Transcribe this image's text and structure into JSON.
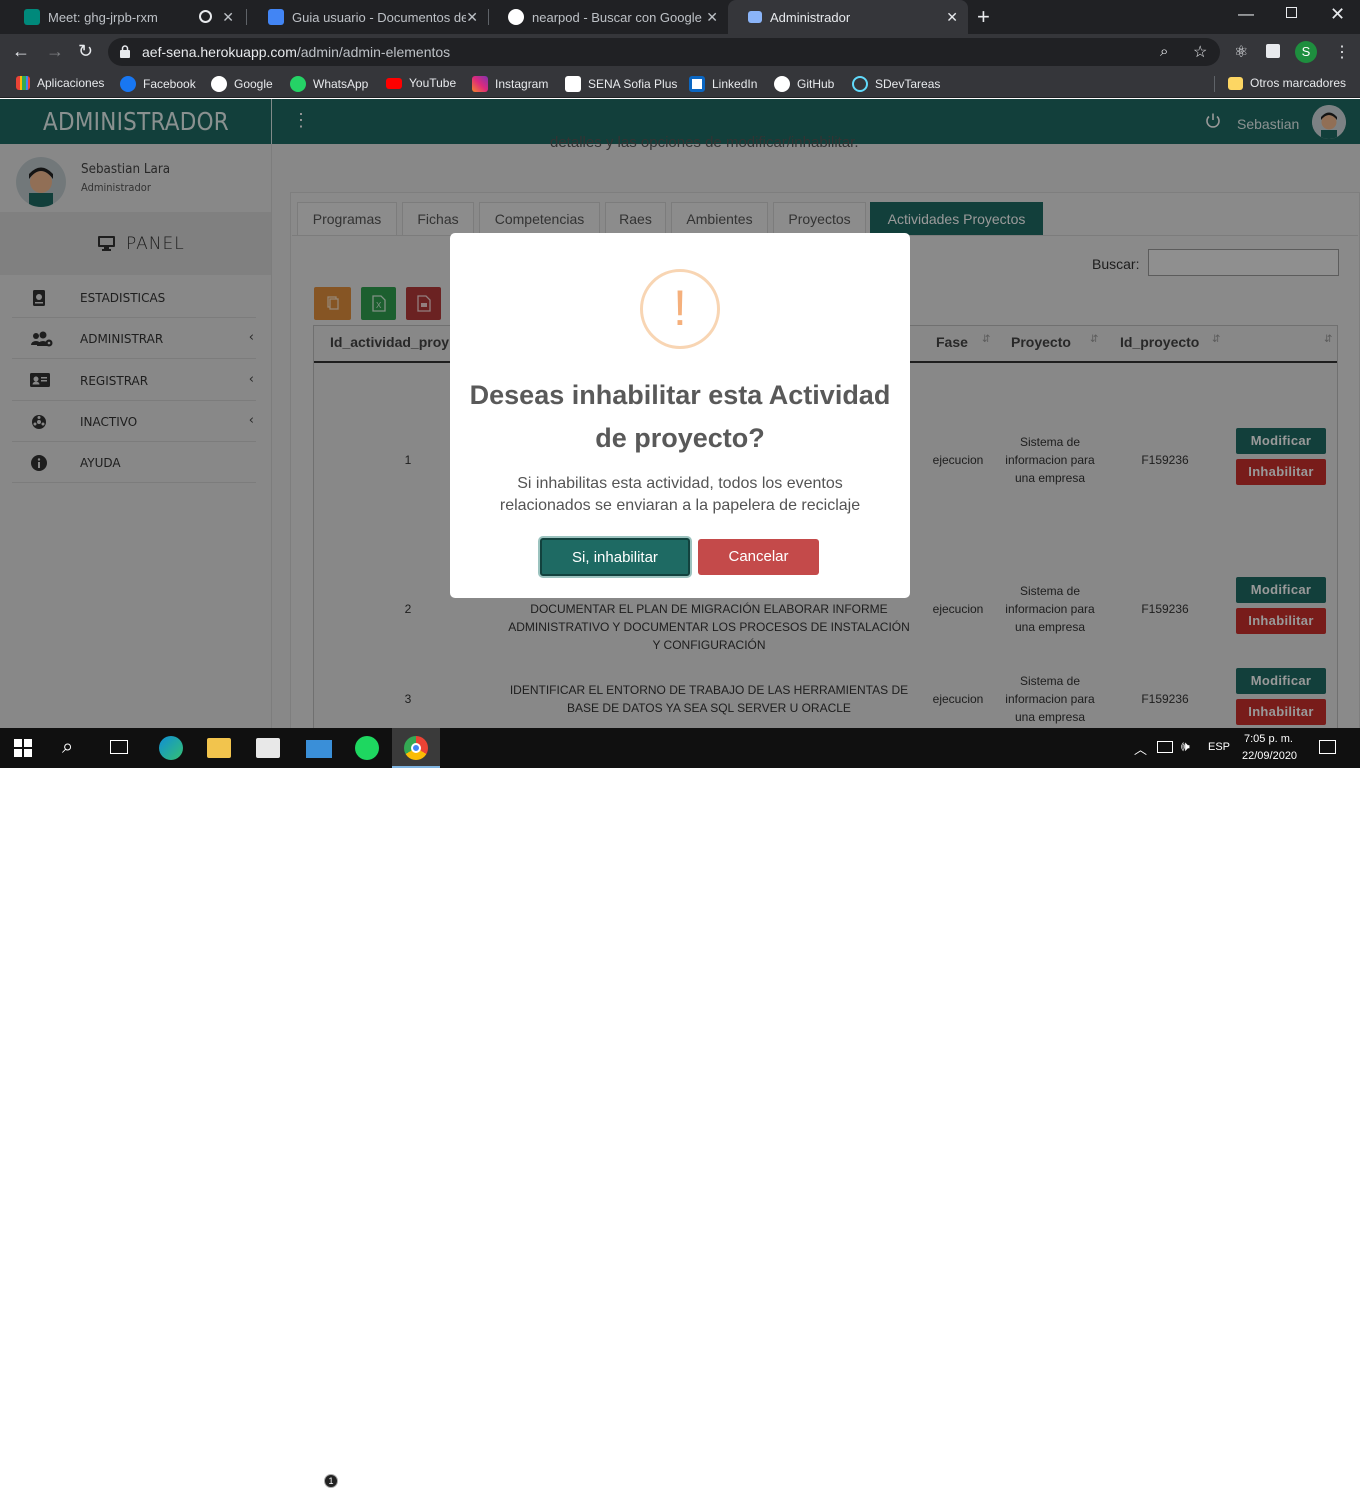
{
  "browser": {
    "tabs": [
      {
        "title": "Meet: ghg-jrpb-rxm",
        "color": "#00897b"
      },
      {
        "title": "Guia usuario - Documentos de G",
        "color": "#4285f4"
      },
      {
        "title": "nearpod - Buscar con Google",
        "color": "#ffffff"
      },
      {
        "title": "Administrador",
        "color": "#8ab4f8"
      }
    ],
    "url_host": "aef-sena.herokuapp.com",
    "url_path": "/admin/admin-elementos",
    "profile_initial": "S",
    "bookmarks": [
      {
        "label": "Aplicaciones",
        "color": "#ea4335"
      },
      {
        "label": "Facebook",
        "color": "#1877f2"
      },
      {
        "label": "Google",
        "color": "#ffffff"
      },
      {
        "label": "WhatsApp",
        "color": "#25d366"
      },
      {
        "label": "YouTube",
        "color": "#ff0000"
      },
      {
        "label": "Instagram",
        "color": "#c13584"
      },
      {
        "label": "SENA Sofia Plus",
        "color": "#ffffff"
      },
      {
        "label": "LinkedIn",
        "color": "#ffffff"
      },
      {
        "label": "GitHub",
        "color": "#ffffff"
      },
      {
        "label": "SDevTareas",
        "color": "#61dafb"
      }
    ],
    "other_bookmarks": "Otros marcadores"
  },
  "app": {
    "brand": "ADMINISTRADOR",
    "top_user": "Sebastian",
    "profile": {
      "name": "Sebastian Lara",
      "role": "Administrador"
    },
    "panel_label": "PANEL",
    "menu": [
      {
        "label": "ESTADISTICAS",
        "icon": "book-icon",
        "has_submenu": false
      },
      {
        "label": "ADMINISTRAR",
        "icon": "users-cog-icon",
        "has_submenu": true
      },
      {
        "label": "REGISTRAR",
        "icon": "id-card-icon",
        "has_submenu": true
      },
      {
        "label": "INACTIVO",
        "icon": "biohazard-icon",
        "has_submenu": true
      },
      {
        "label": "AYUDA",
        "icon": "info-icon",
        "has_submenu": false
      }
    ],
    "intro_text_fragment": "detalles y las opciones de modificar/inhabilitar.",
    "tabs": [
      "Programas",
      "Fichas",
      "Competencias",
      "Raes",
      "Ambientes",
      "Proyectos",
      "Actividades Proyectos"
    ],
    "active_tab": "Actividades Proyectos",
    "search_label": "Buscar:",
    "search_value": "",
    "columns": [
      "Id_actividad_proy",
      "Fase",
      "Proyecto",
      "Id_proyecto"
    ],
    "rows": [
      {
        "id": "1",
        "actividad": "",
        "fase": "ejecucion",
        "proyecto": "Sistema de informacion para una empresa",
        "id_proyecto": "F159236"
      },
      {
        "id": "2",
        "actividad": "DOCUMENTAR EL PLAN DE MIGRACIÓN ELABORAR INFORME ADMINISTRATIVO Y DOCUMENTAR LOS PROCESOS DE INSTALACIÓN Y CONFIGURACIÓN",
        "fase": "ejecucion",
        "proyecto": "Sistema de informacion para una empresa",
        "id_proyecto": "F159236"
      },
      {
        "id": "3",
        "actividad": "IDENTIFICAR EL ENTORNO DE TRABAJO DE LAS HERRAMIENTAS DE BASE DE DATOS YA SEA SQL SERVER U ORACLE",
        "fase": "ejecucion",
        "proyecto": "Sistema de informacion para una empresa",
        "id_proyecto": "F159236"
      }
    ],
    "btn_modify": "Modificar",
    "btn_disable": "Inhabilitar",
    "accent": "#1e6a63",
    "danger": "#c9302c"
  },
  "modal": {
    "icon": "!",
    "title": "Deseas inhabilitar esta Actividad de proyecto?",
    "text": "Si inhabilitas esta actividad, todos los eventos relacionados se enviaran a la papelera de reciclaje",
    "confirm": "Si, inhabilitar",
    "cancel": "Cancelar"
  },
  "taskbar": {
    "lang": "ESP",
    "time": "7:05 p. m.",
    "date": "22/09/2020",
    "mail_badge": "1"
  }
}
